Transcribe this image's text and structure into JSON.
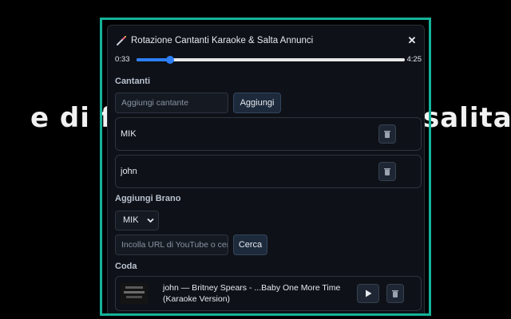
{
  "background_lyrics": {
    "left": "e di fr",
    "right": "salita"
  },
  "header": {
    "title": "Rotazione Cantanti Karaoke & Salta Annunci",
    "close_label": "✕"
  },
  "player": {
    "current_time": "0:33",
    "total_time": "4:25",
    "progress_fraction": 0.124
  },
  "singers_section": {
    "title": "Cantanti",
    "input_placeholder": "Aggiungi cantante",
    "add_label": "Aggiungi",
    "singers": [
      "MIK",
      "john"
    ]
  },
  "add_song_section": {
    "title": "Aggiungi Brano",
    "selected_singer": "MIK",
    "url_placeholder": "Incolla URL di YouTube o cerca",
    "search_label": "Cerca"
  },
  "queue_section": {
    "title": "Coda",
    "items": [
      {
        "text": "john — Britney Spears - ...Baby One More Time (Karaoke Version)"
      }
    ]
  },
  "colors": {
    "accent": "#14b39a",
    "progress": "#2d7ff9",
    "panel": "#0e1117"
  },
  "icons": {
    "title": "magic-wand-icon",
    "delete": "trash-icon",
    "play": "play-icon",
    "dropdown": "chevron-down-icon"
  }
}
